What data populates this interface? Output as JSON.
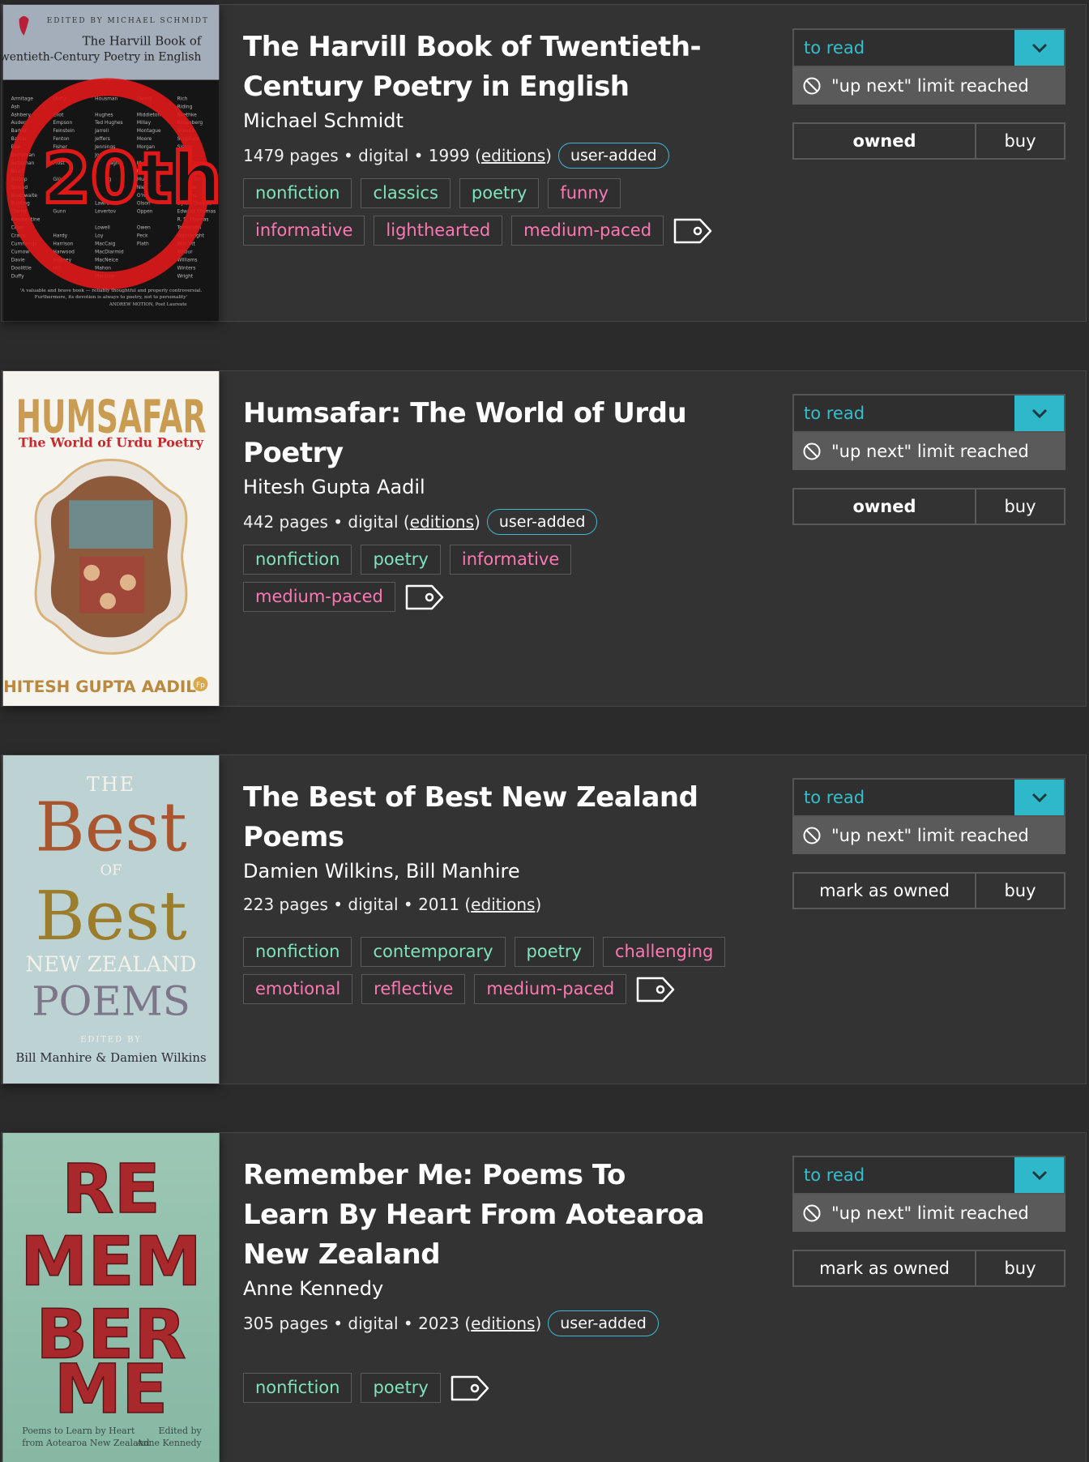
{
  "books": [
    {
      "title": "The Harvill Book of Twentieth-Century Poetry in English",
      "author": "Michael Schmidt",
      "meta_prefix": "1479 pages • digital • 1999 (",
      "editions": "editions",
      "meta_suffix": ")",
      "badge": "user-added",
      "tags_genre": [
        "nonfiction",
        "classics",
        "poetry"
      ],
      "tags_mood": [
        "funny",
        "informative",
        "lighthearted",
        "medium-paced"
      ],
      "status": "to read",
      "limit": "\"up next\" limit reached",
      "owned_label": "owned",
      "buy_label": "buy",
      "cover": {
        "edited": "EDITED BY MICHAEL SCHMIDT",
        "line1": "The Harvill Book of",
        "line2": "Twentieth-Century Poetry in English",
        "big": "20th",
        "quote1": "'A valuable and brave book — reliably thoughtful and properly controversial.",
        "quote2": "Furthermore, its devotion is always to poetry, not to personality'",
        "quote3": "ANDREW MOTION, Poet Laureate"
      }
    },
    {
      "title": "Humsafar: The World of Urdu Poetry",
      "author": "Hitesh Gupta Aadil",
      "meta_prefix": "442 pages • digital (",
      "editions": "editions",
      "meta_suffix": ")",
      "badge": "user-added",
      "tags_genre": [
        "nonfiction",
        "poetry"
      ],
      "tags_mood": [
        "informative",
        "medium-paced"
      ],
      "status": "to read",
      "limit": "\"up next\" limit reached",
      "owned_label": "owned",
      "buy_label": "buy",
      "cover": {
        "title": "HUMSAFAR",
        "subtitle": "The World of Urdu Poetry",
        "author": "HITESH GUPTA AADIL",
        "logo": "Fp"
      }
    },
    {
      "title": "The Best of Best New Zealand Poems",
      "author": "Damien Wilkins, Bill Manhire",
      "meta_prefix": "223 pages • digital • 2011 (",
      "editions": "editions",
      "meta_suffix": ")",
      "badge": "",
      "tags_genre": [
        "nonfiction",
        "contemporary",
        "poetry"
      ],
      "tags_mood": [
        "challenging",
        "emotional",
        "reflective",
        "medium-paced"
      ],
      "status": "to read",
      "limit": "\"up next\" limit reached",
      "owned_label": "mark as owned",
      "buy_label": "buy",
      "cover": {
        "the": "THE",
        "best1": "Best",
        "of": "OF",
        "best2": "Best",
        "nz": "NEW ZEALAND",
        "poems": "POEMS",
        "edited": "EDITED BY",
        "editors": "Bill Manhire & Damien Wilkins"
      }
    },
    {
      "title": "Remember Me: Poems To Learn By Heart From Aotearoa New Zealand",
      "author": "Anne Kennedy",
      "meta_prefix": "305 pages • digital • 2023 (",
      "editions": "editions",
      "meta_suffix": ")",
      "badge": "user-added",
      "tags_genre": [
        "nonfiction",
        "poetry"
      ],
      "tags_mood": [],
      "status": "to read",
      "limit": "\"up next\" limit reached",
      "owned_label": "mark as owned",
      "buy_label": "buy",
      "cover": {
        "l1": "RE",
        "l2": "MEM",
        "l3": "BER",
        "l4": "ME",
        "left1": "Poems to Learn by Heart",
        "left2": "from Aotearoa New Zealand",
        "right1": "Edited by",
        "right2": "Anne Kennedy"
      }
    }
  ],
  "colors": {
    "accent": "#2fb8c9",
    "genre_tag": "#7fe3bd",
    "mood_tag": "#ff78b4",
    "badge_border": "#3fb8d6"
  },
  "icons": {
    "dropdown": "chevron-down-icon",
    "limit": "prohibited-icon",
    "tag": "tag-icon"
  }
}
